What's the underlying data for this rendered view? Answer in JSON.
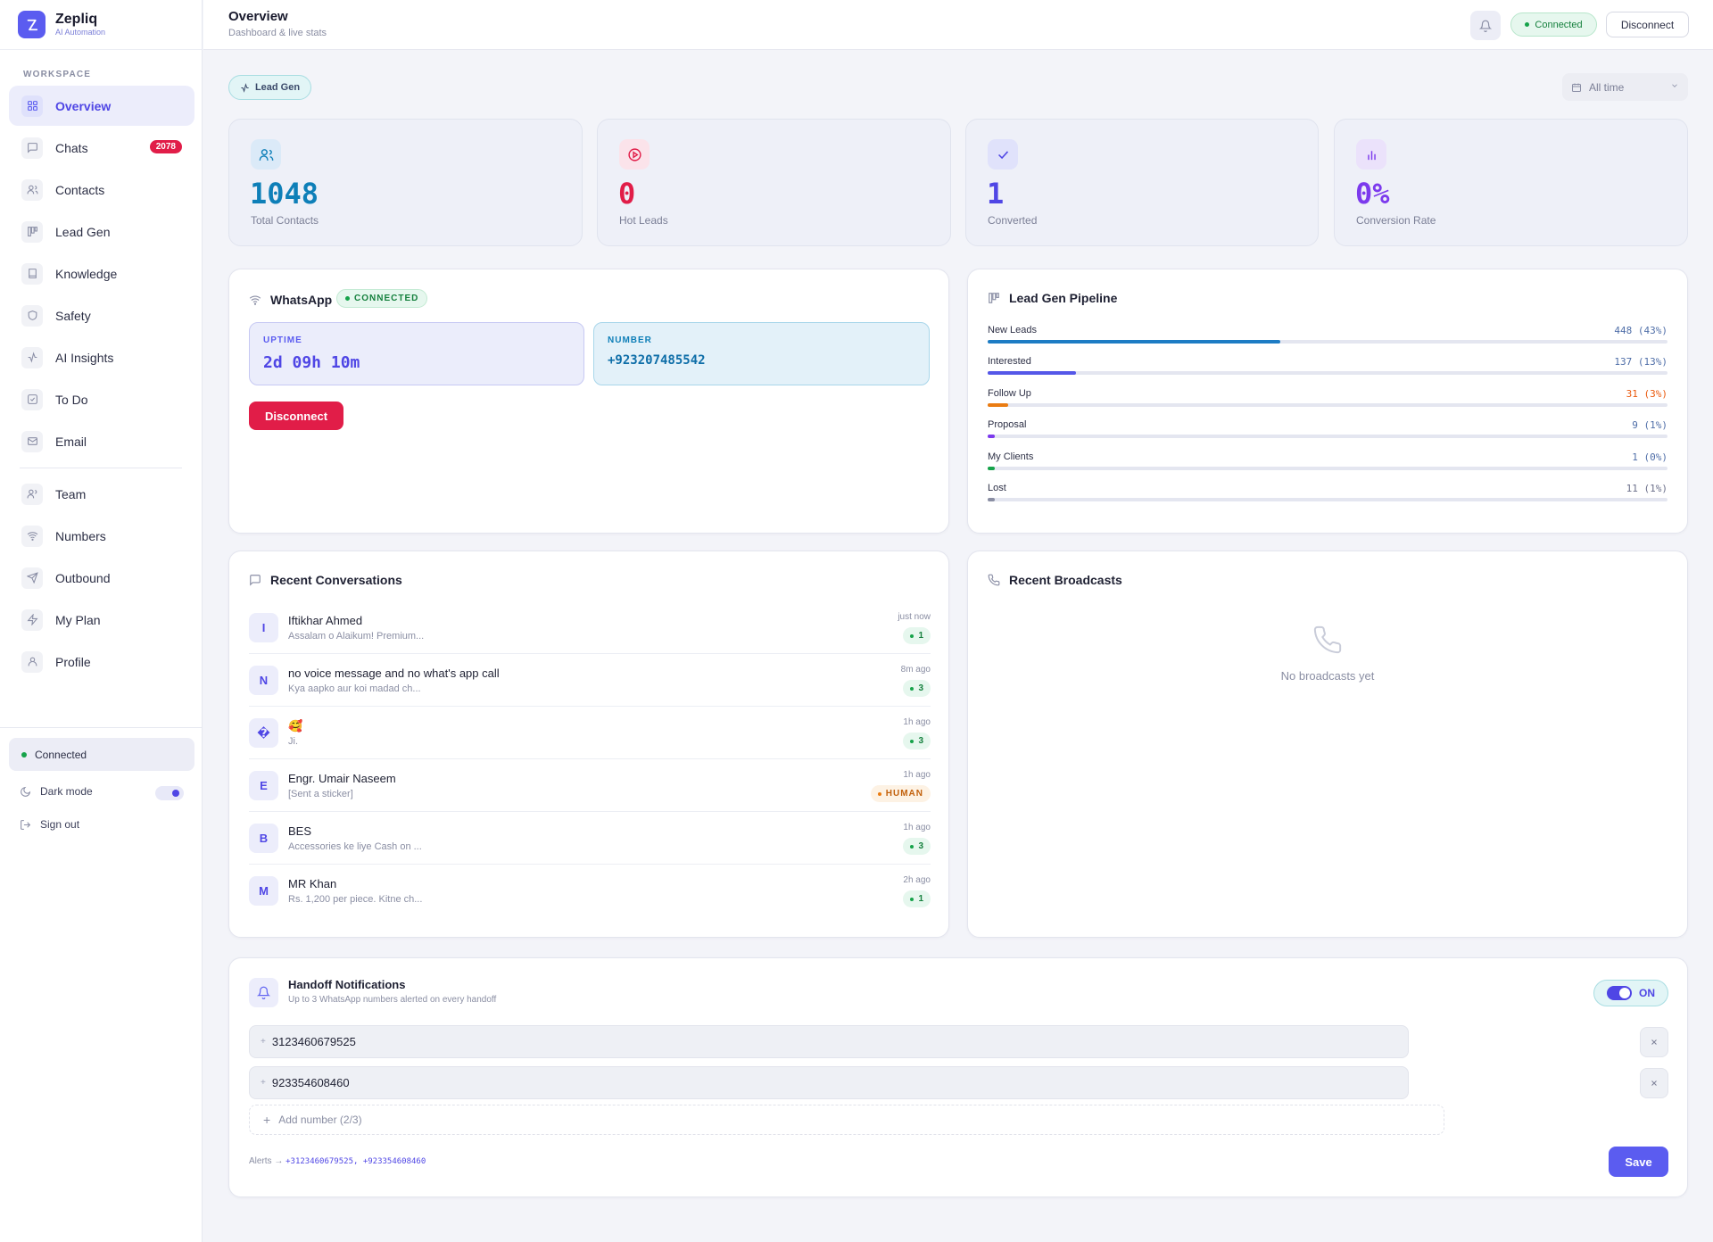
{
  "brand": {
    "name": "Zepliq",
    "subtitle": "AI Automation"
  },
  "sidebar": {
    "section_label": "WORKSPACE",
    "items": [
      {
        "label": "Overview",
        "icon": "grid-icon",
        "active": true
      },
      {
        "label": "Chats",
        "icon": "chat-icon",
        "badge": "2078"
      },
      {
        "label": "Contacts",
        "icon": "users-icon"
      },
      {
        "label": "Lead Gen",
        "icon": "kanban-icon"
      },
      {
        "label": "Knowledge",
        "icon": "book-icon"
      },
      {
        "label": "Safety",
        "icon": "shield-icon"
      },
      {
        "label": "AI Insights",
        "icon": "activity-icon"
      },
      {
        "label": "To Do",
        "icon": "checkbox-icon"
      },
      {
        "label": "Email",
        "icon": "mail-icon"
      },
      {
        "label": "Team",
        "icon": "team-icon"
      },
      {
        "label": "Numbers",
        "icon": "wifi-icon"
      },
      {
        "label": "Outbound",
        "icon": "send-icon"
      },
      {
        "label": "My Plan",
        "icon": "zap-icon"
      },
      {
        "label": "Profile",
        "icon": "user-icon"
      }
    ],
    "status": "Connected",
    "dark_mode_label": "Dark mode",
    "sign_out_label": "Sign out"
  },
  "header": {
    "title": "Overview",
    "subtitle": "Dashboard & live stats",
    "status_pill": "Connected",
    "disconnect_label": "Disconnect"
  },
  "filters": {
    "chip": "Lead Gen",
    "range": "All time"
  },
  "stats": [
    {
      "value": "1048",
      "label": "Total Contacts",
      "color": "#0e7fb8",
      "icon": "users-icon"
    },
    {
      "value": "0",
      "label": "Hot Leads",
      "color": "#e11d48",
      "icon": "play-circle-icon"
    },
    {
      "value": "1",
      "label": "Converted",
      "color": "#4f46e5",
      "icon": "check-icon"
    },
    {
      "value": "0%",
      "label": "Conversion Rate",
      "color": "#7c3aed",
      "icon": "bar-chart-icon"
    }
  ],
  "whatsapp": {
    "title": "WhatsApp",
    "status_badge": "CONNECTED",
    "uptime_label": "UPTIME",
    "uptime_value": "2d 09h 10m",
    "number_label": "NUMBER",
    "number_value": "+923207485542",
    "disconnect_label": "Disconnect"
  },
  "pipeline": {
    "title": "Lead Gen Pipeline",
    "stages": [
      {
        "name": "New Leads",
        "value": "448 (43%)",
        "percent": 43,
        "color": "#1d7cc4",
        "value_color": "#4f6ea8"
      },
      {
        "name": "Interested",
        "value": "137 (13%)",
        "percent": 13,
        "color": "#5557e8",
        "value_color": "#4f6ea8"
      },
      {
        "name": "Follow Up",
        "value": "31 (3%)",
        "percent": 3,
        "color": "#ea7c12",
        "value_color": "#ea580c"
      },
      {
        "name": "Proposal",
        "value": "9 (1%)",
        "percent": 1,
        "color": "#7c3aed",
        "value_color": "#4f6ea8"
      },
      {
        "name": "My Clients",
        "value": "1 (0%)",
        "percent": 0,
        "color": "#16a34a",
        "value_color": "#4f6ea8"
      },
      {
        "name": "Lost",
        "value": "11 (1%)",
        "percent": 1,
        "color": "#8a8ea3",
        "value_color": "#6b6f8a"
      }
    ]
  },
  "conversations": {
    "title": "Recent Conversations",
    "items": [
      {
        "initial": "I",
        "name": "Iftikhar Ahmed",
        "preview": "Assalam o Alaikum! Premium...",
        "time": "just now",
        "count": "1"
      },
      {
        "initial": "N",
        "name": "no voice message and no what's app call",
        "preview": "Kya aapko aur koi madad ch...",
        "time": "8m ago",
        "count": "3"
      },
      {
        "initial": "�",
        "name": "🥰",
        "preview": "Ji.",
        "time": "1h ago",
        "count": "3"
      },
      {
        "initial": "E",
        "name": "Engr. Umair Naseem",
        "preview": "[Sent a sticker]",
        "time": "1h ago",
        "count": "HUMAN",
        "human": true
      },
      {
        "initial": "B",
        "name": "BES",
        "preview": "Accessories ke liye Cash on ...",
        "time": "1h ago",
        "count": "3"
      },
      {
        "initial": "M",
        "name": "MR Khan",
        "preview": "Rs. 1,200 per piece. Kitne ch...",
        "time": "2h ago",
        "count": "1"
      }
    ]
  },
  "broadcasts": {
    "title": "Recent Broadcasts",
    "empty_text": "No broadcasts yet"
  },
  "handoff": {
    "title": "Handoff Notifications",
    "subtitle": "Up to 3 WhatsApp numbers alerted on every handoff",
    "toggle_label": "ON",
    "numbers": [
      "3123460679525",
      "923354608460"
    ],
    "add_label": "Add number (2/3)",
    "alerts_prefix": "Alerts →",
    "alerts_value": "+3123460679525, +923354608460",
    "save_label": "Save"
  }
}
